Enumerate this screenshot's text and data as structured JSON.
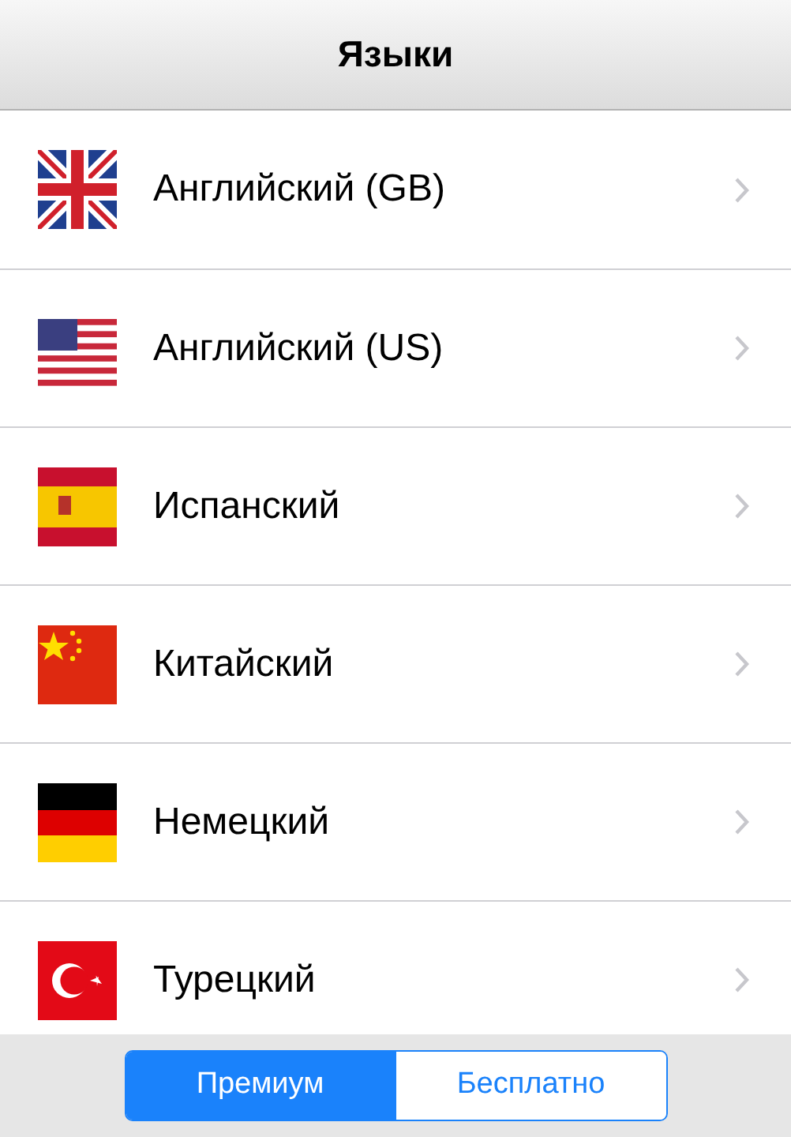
{
  "nav_bar": {
    "title": "Языки"
  },
  "languages": [
    {
      "kind": "gb",
      "label": "Английский (GB)"
    },
    {
      "kind": "us",
      "label": "Английский (US)"
    },
    {
      "kind": "es",
      "label": "Испанский"
    },
    {
      "kind": "cn",
      "label": "Китайский"
    },
    {
      "kind": "de",
      "label": "Немецкий"
    },
    {
      "kind": "tr",
      "label": "Турецкий"
    }
  ],
  "segments": [
    {
      "label": "Премиум",
      "selected": true
    },
    {
      "label": "Бесплатно",
      "selected": false
    }
  ]
}
